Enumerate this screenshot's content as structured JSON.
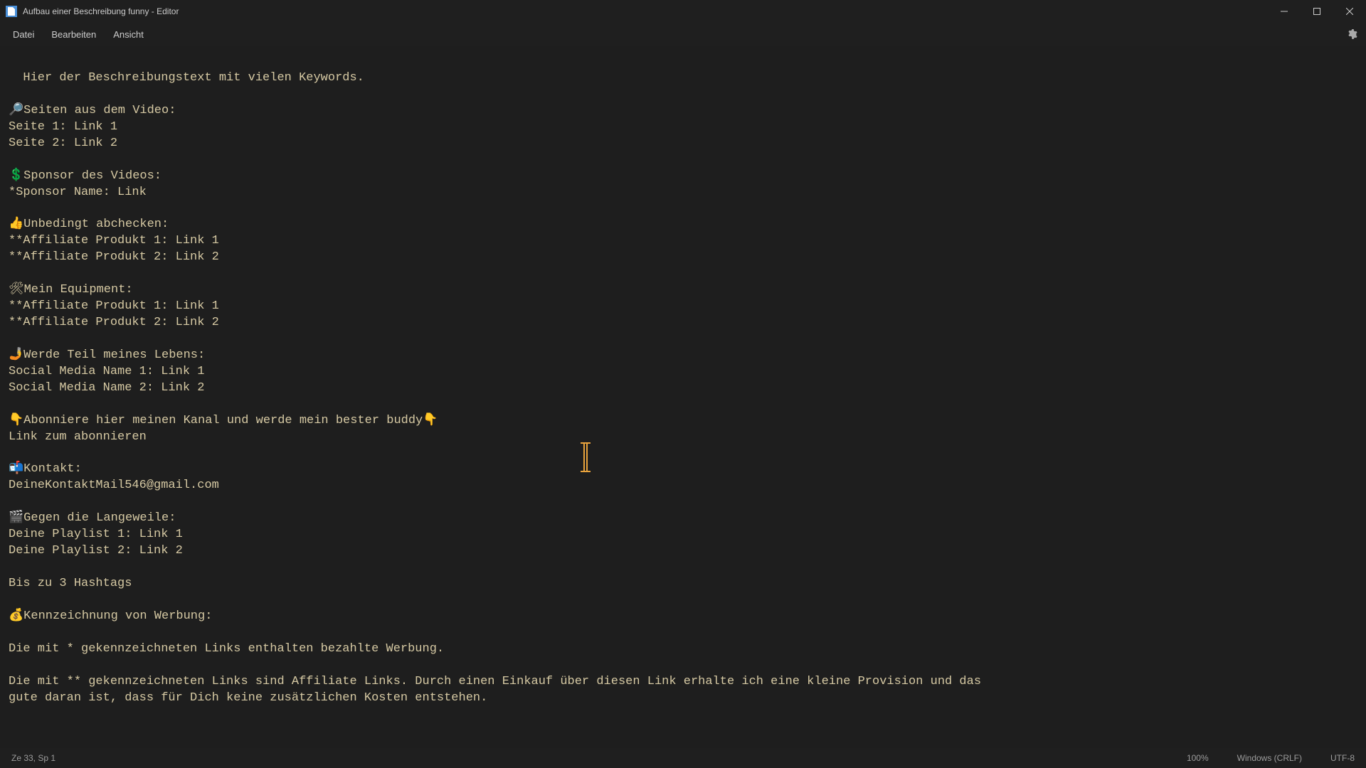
{
  "window": {
    "title": "Aufbau einer Beschreibung funny - Editor"
  },
  "menu": {
    "file": "Datei",
    "edit": "Bearbeiten",
    "view": "Ansicht"
  },
  "editor": {
    "content": "Hier der Beschreibungstext mit vielen Keywords.\n\n🔎Seiten aus dem Video:\nSeite 1: Link 1\nSeite 2: Link 2\n\n💲Sponsor des Videos:\n*Sponsor Name: Link\n\n👍Unbedingt abchecken:\n**Affiliate Produkt 1: Link 1\n**Affiliate Produkt 2: Link 2\n\n🛠Mein Equipment:\n**Affiliate Produkt 1: Link 1\n**Affiliate Produkt 2: Link 2\n\n🤳Werde Teil meines Lebens:\nSocial Media Name 1: Link 1\nSocial Media Name 2: Link 2\n\n👇Abonniere hier meinen Kanal und werde mein bester buddy👇\nLink zum abonnieren\n\n📬Kontakt:\nDeineKontaktMail546@gmail.com\n\n🎬Gegen die Langeweile:\nDeine Playlist 1: Link 1\nDeine Playlist 2: Link 2\n\nBis zu 3 Hashtags\n\n💰Kennzeichnung von Werbung:\n\nDie mit * gekennzeichneten Links enthalten bezahlte Werbung.\n\nDie mit ** gekennzeichneten Links sind Affiliate Links. Durch einen Einkauf über diesen Link erhalte ich eine kleine Provision und das\ngute daran ist, dass für Dich keine zusätzlichen Kosten entstehen."
  },
  "status": {
    "position": "Ze 33, Sp 1",
    "zoom": "100%",
    "line_ending": "Windows (CRLF)",
    "encoding": "UTF-8"
  }
}
